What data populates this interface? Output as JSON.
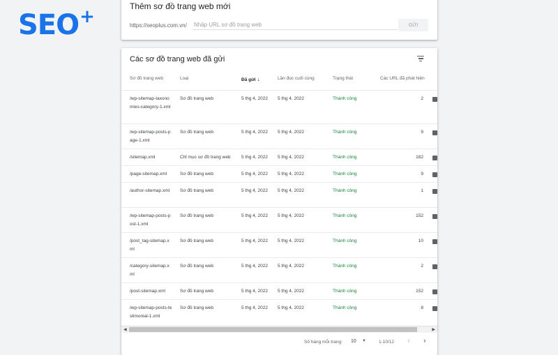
{
  "logo": {
    "text": "SEO",
    "plus": "+"
  },
  "add_card": {
    "title": "Thêm sơ đồ trang web mới",
    "url_prefix": "https://seoplus.com.vn/",
    "input_placeholder": "Nhập URL sơ đồ trang web",
    "submit_label": "GỬI"
  },
  "list_card": {
    "title": "Các sơ đồ trang web đã gửi",
    "columns": {
      "sitemap": "Sơ đồ trang web",
      "type": "Loại",
      "submitted": "Đã gửi",
      "last_read": "Lần đọc cuối cùng",
      "status": "Trạng thái",
      "discovered": "Các URL đã phát hiện"
    },
    "rows": [
      {
        "url": "/wp-sitemap-taxonomies-category-1.xml",
        "type": "Sơ đồ trang web",
        "submitted": "5 thg 4, 2022",
        "last_read": "5 thg 4, 2022",
        "status": "Thành công",
        "count": "2"
      },
      {
        "url": "/wp-sitemap-posts-page-1.xml",
        "type": "Sơ đồ trang web",
        "submitted": "5 thg 4, 2022",
        "last_read": "5 thg 4, 2022",
        "status": "Thành công",
        "count": "9"
      },
      {
        "url": "/sitemap.xml",
        "type": "Chỉ mục sơ đồ trang web",
        "submitted": "5 thg 4, 2022",
        "last_read": "5 thg 4, 2022",
        "status": "Thành công",
        "count": "182"
      },
      {
        "url": "/page-sitemap.xml",
        "type": "Sơ đồ trang web",
        "submitted": "5 thg 4, 2022",
        "last_read": "5 thg 4, 2022",
        "status": "Thành công",
        "count": "9"
      },
      {
        "url": "/author-sitemap.xml",
        "type": "Sơ đồ trang web",
        "submitted": "5 thg 4, 2022",
        "last_read": "5 thg 4, 2022",
        "status": "Thành công",
        "count": "1"
      },
      {
        "url": "/wp-sitemap-posts-post-1.xml",
        "type": "Sơ đồ trang web",
        "submitted": "5 thg 4, 2022",
        "last_read": "5 thg 4, 2022",
        "status": "Thành công",
        "count": "152"
      },
      {
        "url": "/post_tag-sitemap.xml",
        "type": "Sơ đồ trang web",
        "submitted": "5 thg 4, 2022",
        "last_read": "5 thg 4, 2022",
        "status": "Thành công",
        "count": "10"
      },
      {
        "url": "/category-sitemap.xml",
        "type": "Sơ đồ trang web",
        "submitted": "5 thg 4, 2022",
        "last_read": "5 thg 4, 2022",
        "status": "Thành công",
        "count": "2"
      },
      {
        "url": "/post-sitemap.xml",
        "type": "Sơ đồ trang web",
        "submitted": "5 thg 4, 2022",
        "last_read": "5 thg 4, 2022",
        "status": "Thành công",
        "count": "152"
      },
      {
        "url": "/wp-sitemap-posts-testimonial-1.xml",
        "type": "Sơ đồ trang web",
        "submitted": "5 thg 4, 2022",
        "last_read": "5 thg 4, 2022",
        "status": "Thành công",
        "count": "8"
      }
    ]
  },
  "pagination": {
    "rows_per_page_label": "Số hàng mỗi trang:",
    "rows_per_page_value": "10",
    "range_label": "1-10/12"
  },
  "colors": {
    "brand": "#1a73e8",
    "success": "#188038"
  }
}
